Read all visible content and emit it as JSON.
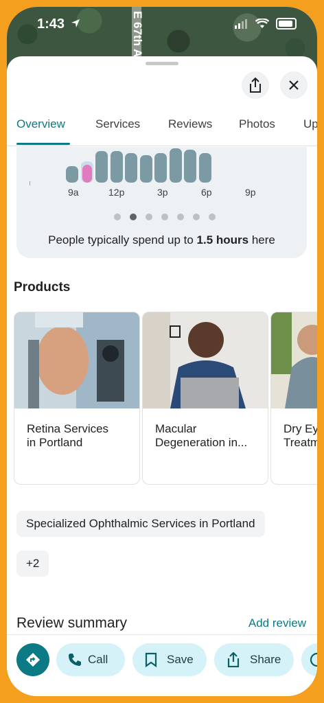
{
  "status": {
    "time": "1:43"
  },
  "map": {
    "street_label": "E 67th A"
  },
  "tabs": [
    {
      "label": "Overview"
    },
    {
      "label": "Services"
    },
    {
      "label": "Reviews"
    },
    {
      "label": "Photos"
    },
    {
      "label": "Up"
    }
  ],
  "popular_times": {
    "hour_labels": [
      "9a",
      "12p",
      "3p",
      "6p",
      "9p"
    ],
    "bar_levels": [
      0.48,
      0.62,
      0.92,
      0.92,
      0.85,
      0.8,
      0.85,
      1.0,
      0.95,
      0.85
    ],
    "live_level": 0.6,
    "page_dots_count": 7,
    "active_dot_index": 1,
    "spend_prefix": "People typically spend up to ",
    "spend_bold": "1.5 hours",
    "spend_suffix": " here"
  },
  "products": {
    "title": "Products",
    "items": [
      {
        "name": "Retina Services\nin Portland"
      },
      {
        "name": "Macular\nDegeneration in..."
      },
      {
        "name": "Dry Ey\nTreatm"
      }
    ]
  },
  "chips": {
    "main": "Specialized Ophthalmic Services in Portland",
    "more": "+2"
  },
  "reviews": {
    "title": "Review summary",
    "add_label": "Add review"
  },
  "actions": {
    "call": "Call",
    "save": "Save",
    "share": "Share"
  },
  "colors": {
    "accent": "#0b7a85",
    "frame": "#f59f1e",
    "bar": "#7c9aa4",
    "live_bar": "#e07bbf",
    "action_bg": "#d4f2f7"
  }
}
